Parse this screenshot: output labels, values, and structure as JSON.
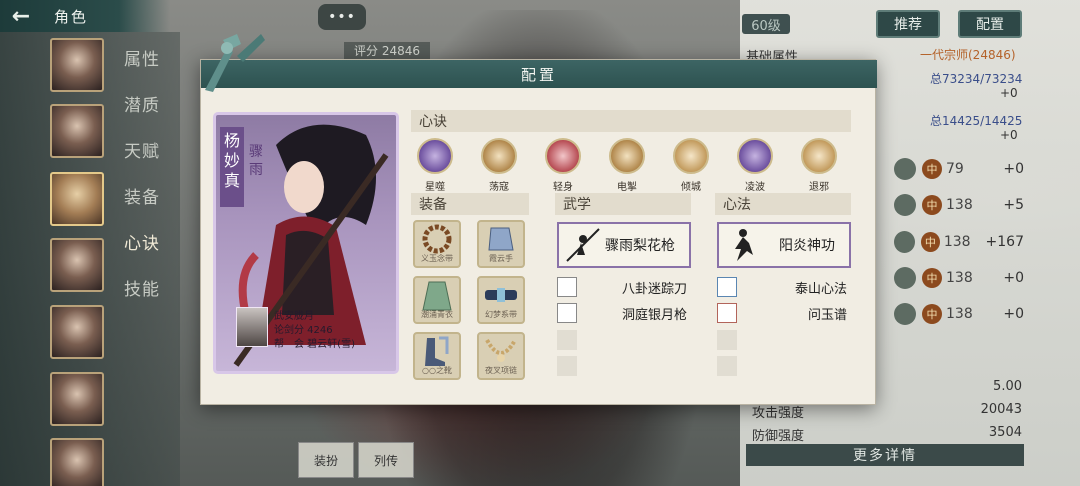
{
  "topbar": {
    "title": "角色"
  },
  "side_tabs": [
    "属性",
    "潜质",
    "天赋",
    "装备",
    "心诀",
    "技能"
  ],
  "chat": {
    "label": "•••"
  },
  "background": {
    "score_label": "评分 24846"
  },
  "right_panel": {
    "level": "60级",
    "recommend_button": "推荐",
    "config_button": "配置",
    "section_title": "基础属性",
    "rank_text": "一代宗师(24846)",
    "rows_text": [
      {
        "left": "总73234/73234",
        "right": "+0"
      },
      {
        "left": "总14425/14425",
        "right": "+0"
      }
    ],
    "stat_rows": [
      {
        "badge": "中",
        "value": "79",
        "plus": "+0"
      },
      {
        "badge": "中",
        "value": "138",
        "plus": "+5"
      },
      {
        "badge": "中",
        "value": "138",
        "plus": "+167"
      },
      {
        "badge": "中",
        "value": "138",
        "plus": "+0"
      },
      {
        "badge": "中",
        "value": "138",
        "plus": "+0"
      }
    ],
    "bottom_stats": [
      {
        "label": "",
        "value": "5.00"
      },
      {
        "label": "攻击强度",
        "value": "20043"
      },
      {
        "label": "防御强度",
        "value": "3504"
      }
    ],
    "more_button": "更多详情"
  },
  "bottom_buttons": {
    "equip": "装扮",
    "biography": "列传"
  },
  "modal": {
    "title": "配置",
    "character": {
      "name": "杨妙真",
      "alias": "骤雨",
      "school": "武安胧月",
      "score": "论剑分 4246",
      "guild": "帮　会 碧云轩(雪)"
    },
    "sections": {
      "skills": "心诀",
      "equipment": "装备",
      "martial": "武学",
      "heart": "心法"
    },
    "skills": [
      {
        "label": "星噬",
        "color": "#6c4f9e"
      },
      {
        "label": "荡寇",
        "color": "#b0864a"
      },
      {
        "label": "轻身",
        "color": "#b64a52"
      },
      {
        "label": "电掣",
        "color": "#b0864a"
      },
      {
        "label": "倾城",
        "color": "#c29a5c"
      },
      {
        "label": "凌波",
        "color": "#6c4f9e"
      },
      {
        "label": "退邪",
        "color": "#c29a5c"
      }
    ],
    "equipment": [
      {
        "label": "义玉念带"
      },
      {
        "label": "霞云手"
      },
      {
        "label": "潮涌青衣"
      },
      {
        "label": "幻梦系带"
      },
      {
        "label": "○○之靴"
      },
      {
        "label": "夜叉项链"
      }
    ],
    "martial": {
      "main": "骤雨梨花枪",
      "subs": [
        "八卦迷踪刀",
        "洞庭银月枪"
      ]
    },
    "heart": {
      "main": "阳炎神功",
      "subs": [
        "泰山心法",
        "问玉谱"
      ]
    }
  }
}
